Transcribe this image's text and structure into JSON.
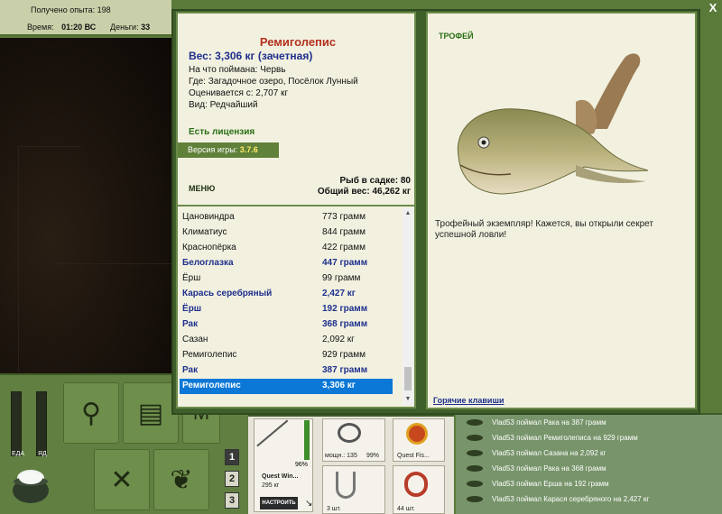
{
  "hud": {
    "xp_label": "Получено опыта:",
    "xp_value": "198",
    "time_label": "Время:",
    "time_value": "01:20 ВС",
    "money_label": "Деньги:",
    "money_value": "33"
  },
  "meters": {
    "food_label": "ЕДА",
    "poison_label": "ЯД",
    "food_level": 0.0,
    "poison_level": 0.0
  },
  "panel_numbers": [
    "1",
    "2",
    "3"
  ],
  "gear": {
    "rod_name": "Quest Win...",
    "rod_weight": "295 кг",
    "rod_durability": "96%",
    "reel_label": "мощн.: 135",
    "reel_durability": "99%",
    "line_name": "Quest Fis...",
    "hook_count": "3 шт.",
    "bait_count": "44 шт.",
    "setup_button": "НАСТРОИТЬ"
  },
  "feed": [
    "Vlad53 поймал Рака на 387 грамм",
    "Vlad53 поймал Ремиголеписа на 929 грамм",
    "Vlad53 поймал Сазана на 2,092 кг",
    "Vlad53 поймал Рака на 368 грамм",
    "Vlad53 поймал Ерша на 192 грамм",
    "Vlad53 поймал Карася серебряного на 2,427 кг"
  ],
  "info": {
    "name": "Ремиголепис",
    "weight": "Вес: 3,306 кг (зачетная)",
    "bait": "На что поймана: Червь",
    "where": "Где: Загадочное озеро, Посёлок Лунный",
    "price": "Оценивается с: 2,707 кг",
    "kind": "Вид: Редчайший",
    "license": "Есть лицензия",
    "version_label": "Версия игры:",
    "version_value": "3.7.6",
    "menu": "МЕНЮ",
    "fish_in_net": "Рыб в садке: 80",
    "total_weight": "Общий вес: 46,262 кг"
  },
  "catches": [
    {
      "name": "Цановиндра",
      "weight": "773 грамм",
      "bold": false
    },
    {
      "name": "Климатиус",
      "weight": "844 грамм",
      "bold": false
    },
    {
      "name": "Краснопёрка",
      "weight": "422 грамм",
      "bold": false
    },
    {
      "name": "Белоглазка",
      "weight": "447 грамм",
      "bold": true
    },
    {
      "name": "Ёрш",
      "weight": "99 грамм",
      "bold": false
    },
    {
      "name": "Карась серебряный",
      "weight": "2,427 кг",
      "bold": true
    },
    {
      "name": "Ёрш",
      "weight": "192 грамм",
      "bold": true
    },
    {
      "name": "Рак",
      "weight": "368 грамм",
      "bold": true
    },
    {
      "name": "Сазан",
      "weight": "2,092 кг",
      "bold": false
    },
    {
      "name": "Ремиголепис",
      "weight": "929 грамм",
      "bold": false
    },
    {
      "name": "Рак",
      "weight": "387 грамм",
      "bold": true
    },
    {
      "name": "Ремиголепис",
      "weight": "3,306 кг",
      "bold": true,
      "selected": true
    }
  ],
  "trophy": {
    "title": "ТРОФЕЙ",
    "text": "Трофейный экземпляр! Кажется, вы открыли секрет успешной ловли!",
    "hotkeys": "Горячие клавиши"
  },
  "close_label": "X",
  "colors": {
    "name_red": "#b3311f",
    "accent_blue": "#1e2f8c",
    "license_green": "#2a6e14",
    "selected_row": "#0b78d7"
  }
}
